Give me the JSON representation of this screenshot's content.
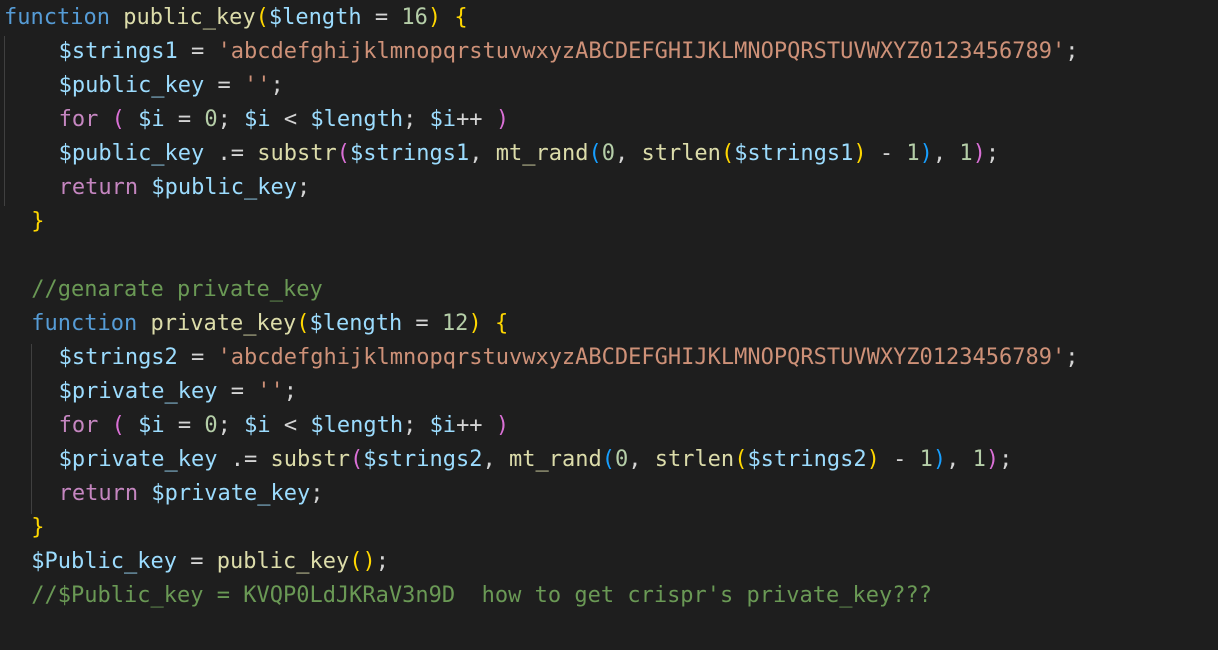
{
  "colors": {
    "background": "#1e1e1e",
    "default": "#d4d4d4",
    "keyword": "#569cd6",
    "control": "#c586c0",
    "function": "#dcdcaa",
    "variable": "#9cdcfe",
    "string": "#ce9178",
    "number": "#b5cea8",
    "comment": "#6a9955",
    "bracket1": "#ffd700",
    "bracket2": "#da70d6",
    "bracket3": "#179fff"
  },
  "lines": [
    {
      "indent": 0,
      "tokens": [
        {
          "t": "function",
          "c": "kw"
        },
        {
          "t": " ",
          "c": "pl"
        },
        {
          "t": "public_key",
          "c": "fn"
        },
        {
          "t": "(",
          "c": "b1"
        },
        {
          "t": "$length",
          "c": "var"
        },
        {
          "t": " = ",
          "c": "pl"
        },
        {
          "t": "16",
          "c": "num"
        },
        {
          "t": ")",
          "c": "b1"
        },
        {
          "t": " ",
          "c": "pl"
        },
        {
          "t": "{",
          "c": "b1"
        }
      ]
    },
    {
      "indent": 2,
      "tokens": [
        {
          "t": "$strings1",
          "c": "var"
        },
        {
          "t": " = ",
          "c": "pl"
        },
        {
          "t": "'abcdefghijklmnopqrstuvwxyzABCDEFGHIJKLMNOPQRSTUVWXYZ0123456789'",
          "c": "str"
        },
        {
          "t": ";",
          "c": "pl"
        }
      ]
    },
    {
      "indent": 2,
      "tokens": [
        {
          "t": "$public_key",
          "c": "var"
        },
        {
          "t": " = ",
          "c": "pl"
        },
        {
          "t": "''",
          "c": "str"
        },
        {
          "t": ";",
          "c": "pl"
        }
      ]
    },
    {
      "indent": 2,
      "tokens": [
        {
          "t": "for",
          "c": "ctl"
        },
        {
          "t": " ",
          "c": "pl"
        },
        {
          "t": "(",
          "c": "b2"
        },
        {
          "t": " ",
          "c": "pl"
        },
        {
          "t": "$i",
          "c": "var"
        },
        {
          "t": " = ",
          "c": "pl"
        },
        {
          "t": "0",
          "c": "num"
        },
        {
          "t": "; ",
          "c": "pl"
        },
        {
          "t": "$i",
          "c": "var"
        },
        {
          "t": " < ",
          "c": "pl"
        },
        {
          "t": "$length",
          "c": "var"
        },
        {
          "t": "; ",
          "c": "pl"
        },
        {
          "t": "$i",
          "c": "var"
        },
        {
          "t": "++ ",
          "c": "pl"
        },
        {
          "t": ")",
          "c": "b2"
        }
      ]
    },
    {
      "indent": 2,
      "tokens": [
        {
          "t": "$public_key",
          "c": "var"
        },
        {
          "t": " .= ",
          "c": "pl"
        },
        {
          "t": "substr",
          "c": "fn"
        },
        {
          "t": "(",
          "c": "b2"
        },
        {
          "t": "$strings1",
          "c": "var"
        },
        {
          "t": ", ",
          "c": "pl"
        },
        {
          "t": "mt_rand",
          "c": "fn"
        },
        {
          "t": "(",
          "c": "b3"
        },
        {
          "t": "0",
          "c": "num"
        },
        {
          "t": ", ",
          "c": "pl"
        },
        {
          "t": "strlen",
          "c": "fn"
        },
        {
          "t": "(",
          "c": "b1"
        },
        {
          "t": "$strings1",
          "c": "var"
        },
        {
          "t": ")",
          "c": "b1"
        },
        {
          "t": " - ",
          "c": "pl"
        },
        {
          "t": "1",
          "c": "num"
        },
        {
          "t": ")",
          "c": "b3"
        },
        {
          "t": ", ",
          "c": "pl"
        },
        {
          "t": "1",
          "c": "num"
        },
        {
          "t": ")",
          "c": "b2"
        },
        {
          "t": ";",
          "c": "pl"
        }
      ]
    },
    {
      "indent": 2,
      "tokens": [
        {
          "t": "return",
          "c": "ctl"
        },
        {
          "t": " ",
          "c": "pl"
        },
        {
          "t": "$public_key",
          "c": "var"
        },
        {
          "t": ";",
          "c": "pl"
        }
      ]
    },
    {
      "indent": 1,
      "tokens": [
        {
          "t": "}",
          "c": "b1"
        }
      ]
    },
    {
      "indent": 0,
      "tokens": []
    },
    {
      "indent": 1,
      "tokens": [
        {
          "t": "//genarate private_key",
          "c": "cmt"
        }
      ]
    },
    {
      "indent": 1,
      "tokens": [
        {
          "t": "function",
          "c": "kw"
        },
        {
          "t": " ",
          "c": "pl"
        },
        {
          "t": "private_key",
          "c": "fn"
        },
        {
          "t": "(",
          "c": "b1"
        },
        {
          "t": "$length",
          "c": "var"
        },
        {
          "t": " = ",
          "c": "pl"
        },
        {
          "t": "12",
          "c": "num"
        },
        {
          "t": ")",
          "c": "b1"
        },
        {
          "t": " ",
          "c": "pl"
        },
        {
          "t": "{",
          "c": "b1"
        }
      ]
    },
    {
      "indent": 2,
      "tokens": [
        {
          "t": "$strings2",
          "c": "var"
        },
        {
          "t": " = ",
          "c": "pl"
        },
        {
          "t": "'abcdefghijklmnopqrstuvwxyzABCDEFGHIJKLMNOPQRSTUVWXYZ0123456789'",
          "c": "str"
        },
        {
          "t": ";",
          "c": "pl"
        }
      ]
    },
    {
      "indent": 2,
      "tokens": [
        {
          "t": "$private_key",
          "c": "var"
        },
        {
          "t": " = ",
          "c": "pl"
        },
        {
          "t": "''",
          "c": "str"
        },
        {
          "t": ";",
          "c": "pl"
        }
      ]
    },
    {
      "indent": 2,
      "tokens": [
        {
          "t": "for",
          "c": "ctl"
        },
        {
          "t": " ",
          "c": "pl"
        },
        {
          "t": "(",
          "c": "b2"
        },
        {
          "t": " ",
          "c": "pl"
        },
        {
          "t": "$i",
          "c": "var"
        },
        {
          "t": " = ",
          "c": "pl"
        },
        {
          "t": "0",
          "c": "num"
        },
        {
          "t": "; ",
          "c": "pl"
        },
        {
          "t": "$i",
          "c": "var"
        },
        {
          "t": " < ",
          "c": "pl"
        },
        {
          "t": "$length",
          "c": "var"
        },
        {
          "t": "; ",
          "c": "pl"
        },
        {
          "t": "$i",
          "c": "var"
        },
        {
          "t": "++ ",
          "c": "pl"
        },
        {
          "t": ")",
          "c": "b2"
        }
      ]
    },
    {
      "indent": 2,
      "tokens": [
        {
          "t": "$private_key",
          "c": "var"
        },
        {
          "t": " .= ",
          "c": "pl"
        },
        {
          "t": "substr",
          "c": "fn"
        },
        {
          "t": "(",
          "c": "b2"
        },
        {
          "t": "$strings2",
          "c": "var"
        },
        {
          "t": ", ",
          "c": "pl"
        },
        {
          "t": "mt_rand",
          "c": "fn"
        },
        {
          "t": "(",
          "c": "b3"
        },
        {
          "t": "0",
          "c": "num"
        },
        {
          "t": ", ",
          "c": "pl"
        },
        {
          "t": "strlen",
          "c": "fn"
        },
        {
          "t": "(",
          "c": "b1"
        },
        {
          "t": "$strings2",
          "c": "var"
        },
        {
          "t": ")",
          "c": "b1"
        },
        {
          "t": " - ",
          "c": "pl"
        },
        {
          "t": "1",
          "c": "num"
        },
        {
          "t": ")",
          "c": "b3"
        },
        {
          "t": ", ",
          "c": "pl"
        },
        {
          "t": "1",
          "c": "num"
        },
        {
          "t": ")",
          "c": "b2"
        },
        {
          "t": ";",
          "c": "pl"
        }
      ]
    },
    {
      "indent": 2,
      "tokens": [
        {
          "t": "return",
          "c": "ctl"
        },
        {
          "t": " ",
          "c": "pl"
        },
        {
          "t": "$private_key",
          "c": "var"
        },
        {
          "t": ";",
          "c": "pl"
        }
      ]
    },
    {
      "indent": 1,
      "tokens": [
        {
          "t": "}",
          "c": "b1"
        }
      ]
    },
    {
      "indent": 1,
      "tokens": [
        {
          "t": "$Public_key",
          "c": "var"
        },
        {
          "t": " = ",
          "c": "pl"
        },
        {
          "t": "public_key",
          "c": "fn"
        },
        {
          "t": "(",
          "c": "b1"
        },
        {
          "t": ")",
          "c": "b1"
        },
        {
          "t": ";",
          "c": "pl"
        }
      ]
    },
    {
      "indent": 1,
      "tokens": [
        {
          "t": "//$Public_key = KVQP0LdJKRaV3n9D  how to get crispr's private_key???",
          "c": "cmt"
        }
      ]
    }
  ]
}
